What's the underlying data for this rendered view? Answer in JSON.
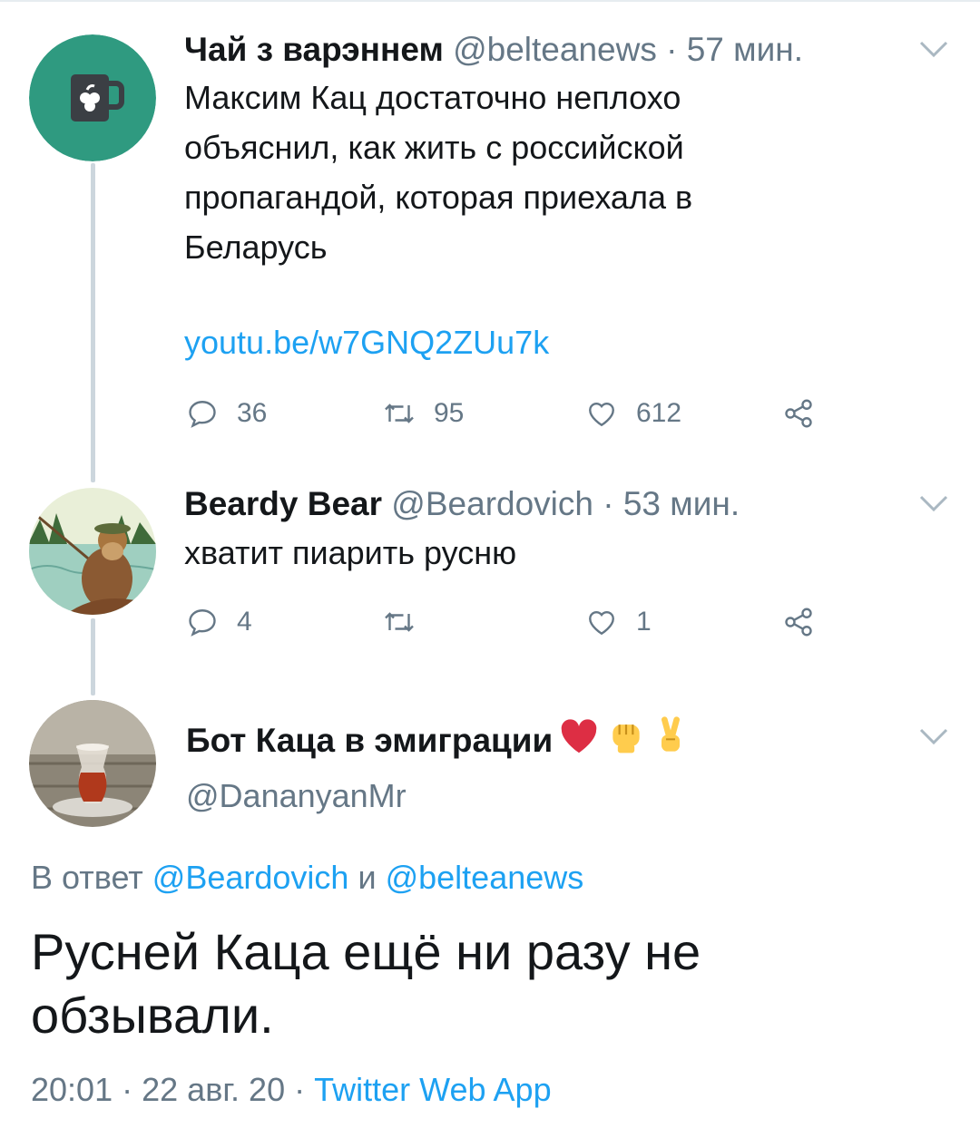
{
  "tweet1": {
    "display_name": "Чай з варэннем",
    "handle": "@belteanews",
    "separator": "·",
    "time": "57 мин.",
    "text_lines": [
      "Максим Кац достаточно неплохо",
      "объяснил, как жить с российской",
      "пропагандой, которая приехала в",
      "Беларусь"
    ],
    "link": "youtu.be/w7GNQ2ZUu7k",
    "replies": "36",
    "retweets": "95",
    "likes": "612"
  },
  "tweet2": {
    "display_name": "Beardy Bear",
    "handle": "@Beardovich",
    "separator": "·",
    "time": "53 мин.",
    "text": "хватит пиарить русню",
    "replies": "4",
    "retweets": "",
    "likes": "1"
  },
  "tweet3": {
    "display_name": "Бот Каца в эмиграции",
    "handle": "@DananyanMr",
    "reply_prefix": "В ответ",
    "reply_user1": "@Beardovich",
    "reply_conj": "и",
    "reply_user2": "@belteanews",
    "text_lines": [
      "Русней Каца ещё ни разу не",
      "обзывали."
    ],
    "time": "20:01",
    "separator": "·",
    "date": "22 авг. 20",
    "app": "Twitter Web App"
  },
  "icons": {
    "reply": "reply-icon",
    "retweet": "retweet-icon",
    "like": "heart-icon",
    "share": "share-icon",
    "menu": "chevron-down-icon",
    "emoji": [
      "red-heart-emoji",
      "raised-fist-emoji",
      "victory-hand-emoji"
    ]
  },
  "colors": {
    "link": "#1da1f2",
    "muted": "#657786",
    "text": "#14171a",
    "thread_line": "#ccd6dd",
    "avatar1_bg": "#2f9a80"
  }
}
